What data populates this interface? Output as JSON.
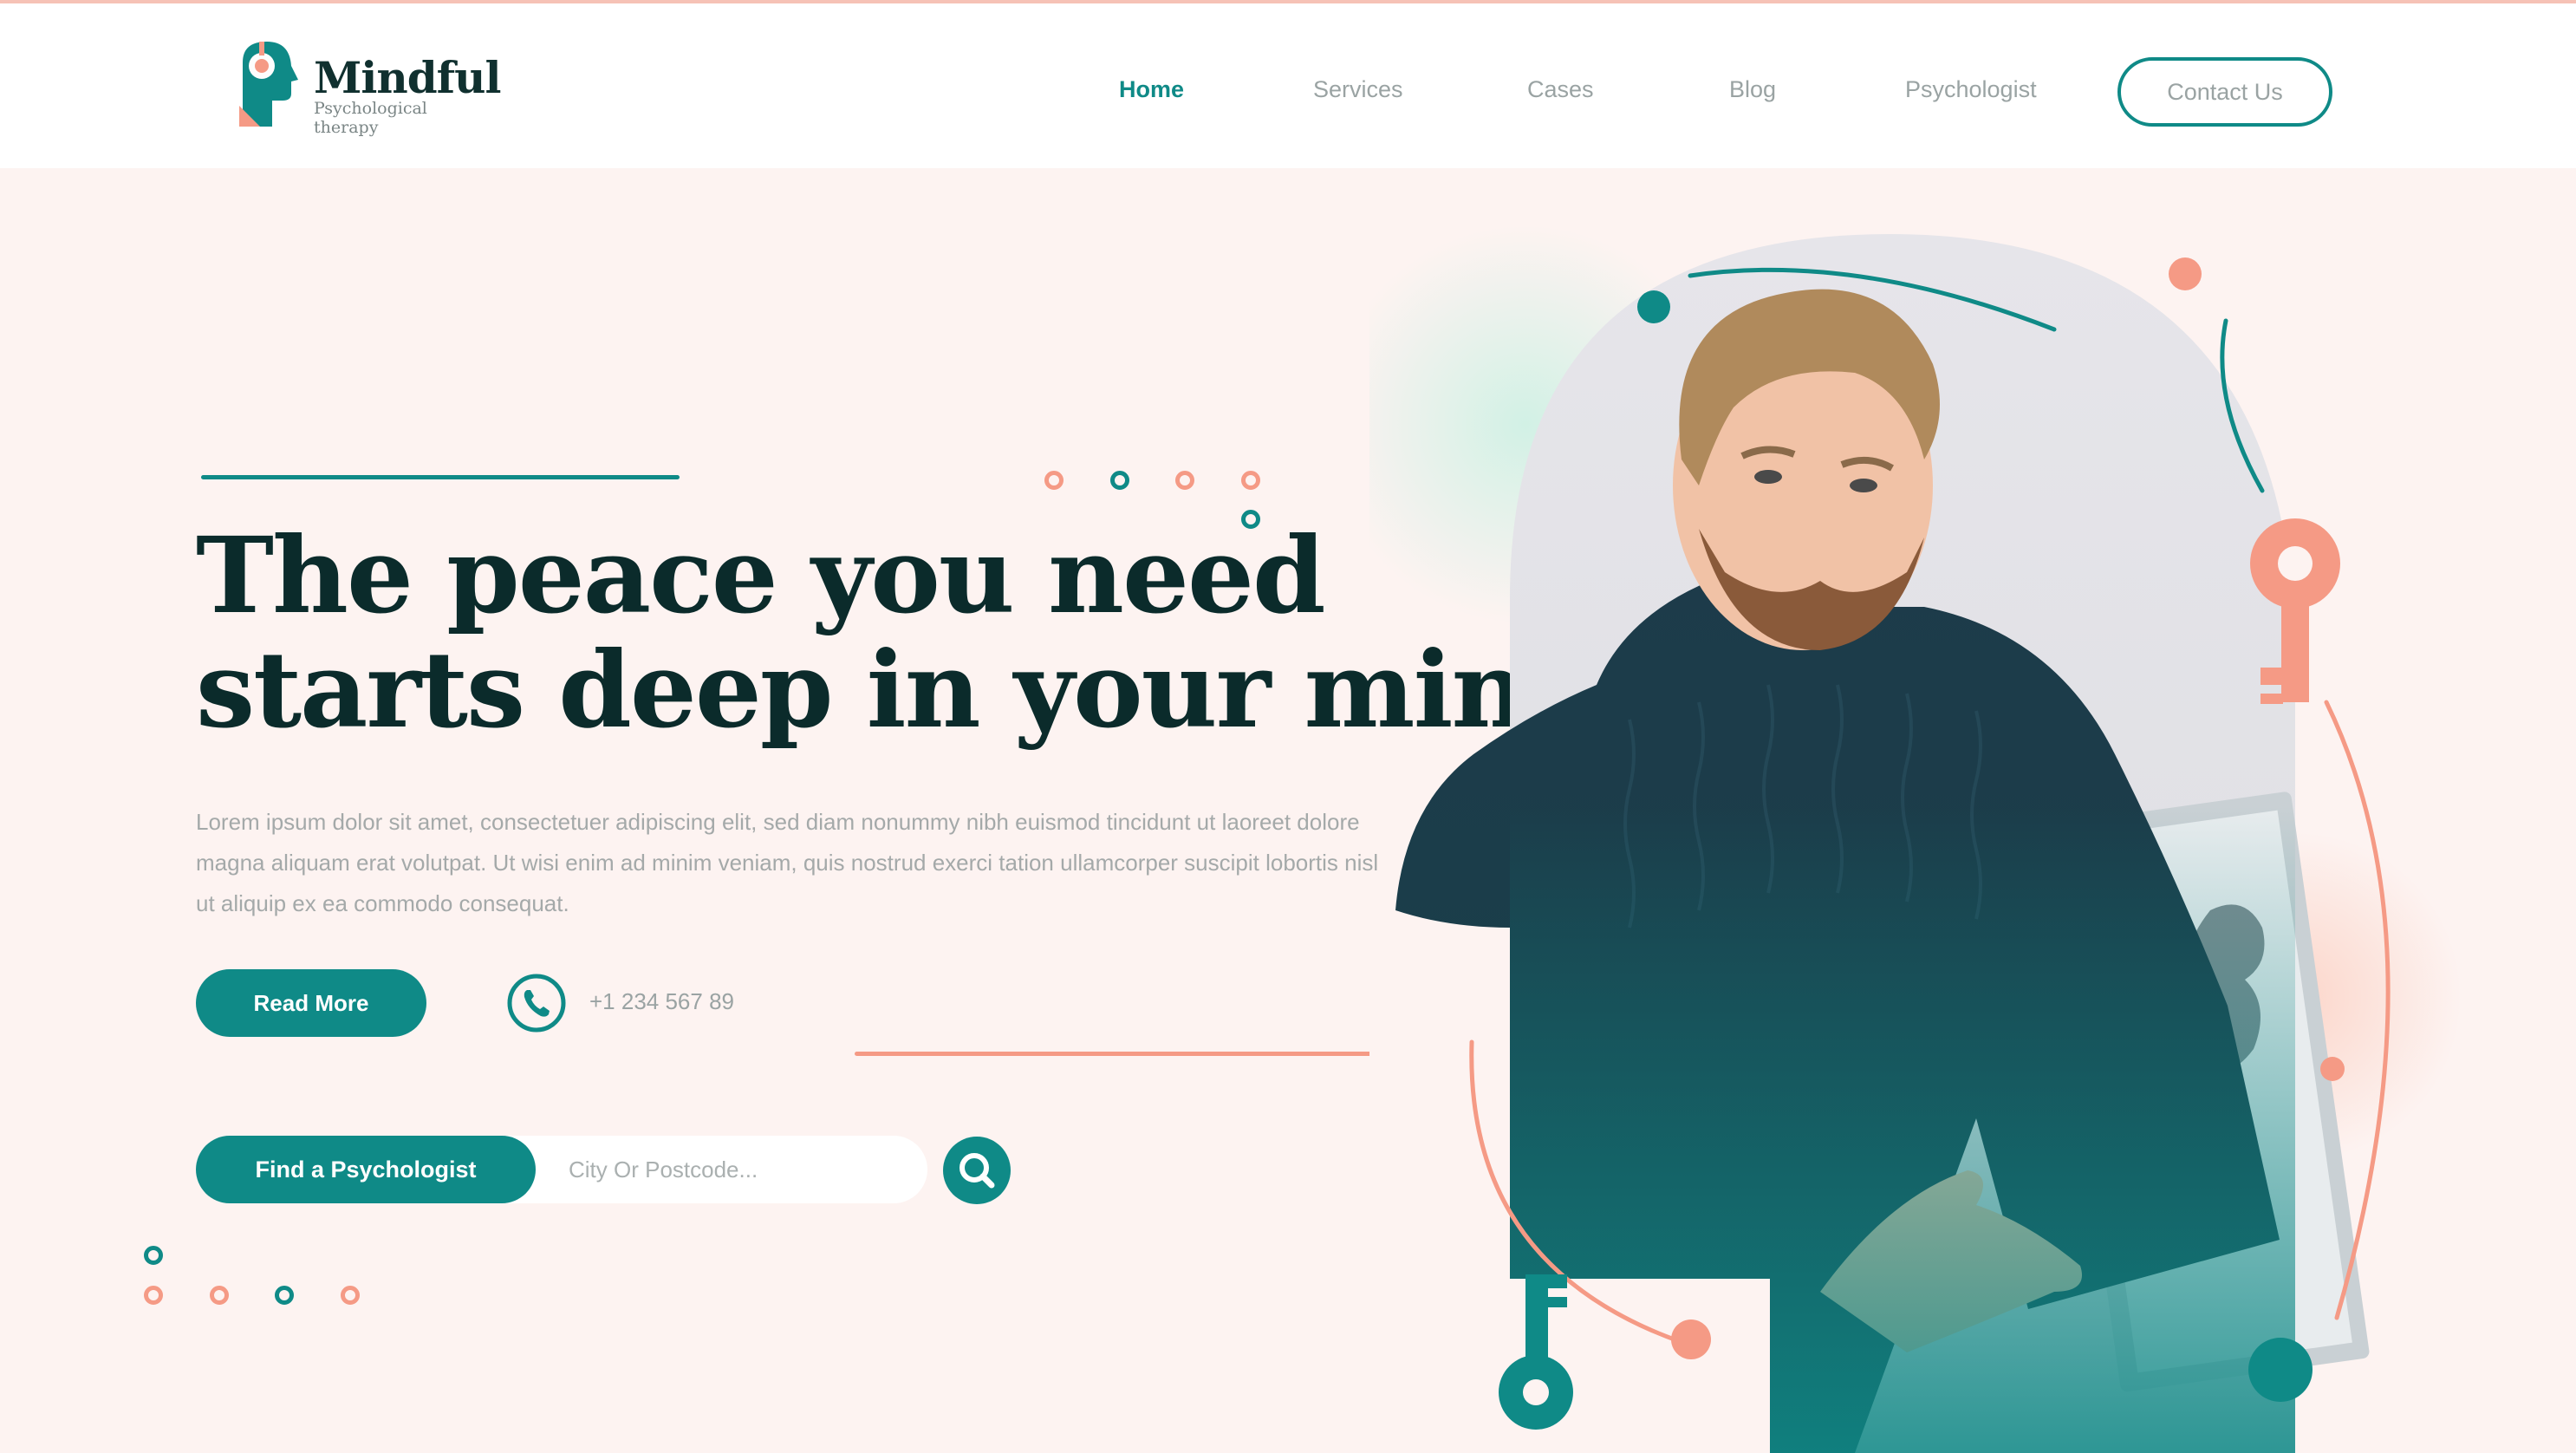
{
  "brand": {
    "name": "Mindful",
    "tagline": "Psychological therapy"
  },
  "nav": {
    "items": [
      {
        "label": "Home",
        "active": true
      },
      {
        "label": "Services",
        "active": false
      },
      {
        "label": "Cases",
        "active": false
      },
      {
        "label": "Blog",
        "active": false
      },
      {
        "label": "Psychologist",
        "active": false
      }
    ],
    "contact_label": "Contact Us"
  },
  "hero": {
    "headline_line1": "The peace you need",
    "headline_line2": "starts deep in your mind.",
    "body": "Lorem ipsum dolor sit amet, consectetuer adipiscing elit, sed diam nonummy nibh euismod tincidunt ut laoreet dolore magna aliquam erat volutpat. Ut wisi enim ad minim veniam, quis nostrud exerci tation ullamcorper suscipit lobortis nisl ut aliquip ex ea commodo consequat.",
    "read_more_label": "Read More",
    "phone": "+1 234 567 89"
  },
  "search": {
    "find_label": "Find a Psychologist",
    "placeholder": "City Or Postcode...",
    "value": ""
  },
  "colors": {
    "accent_teal": "#0f8a87",
    "accent_coral": "#f59a85",
    "heading": "#0b2b2b",
    "background": "#fdf3f1"
  },
  "icons": {
    "logo": "head-with-keyhole-icon",
    "phone": "phone-icon",
    "search": "magnifier-icon",
    "keys": "key-icon"
  }
}
